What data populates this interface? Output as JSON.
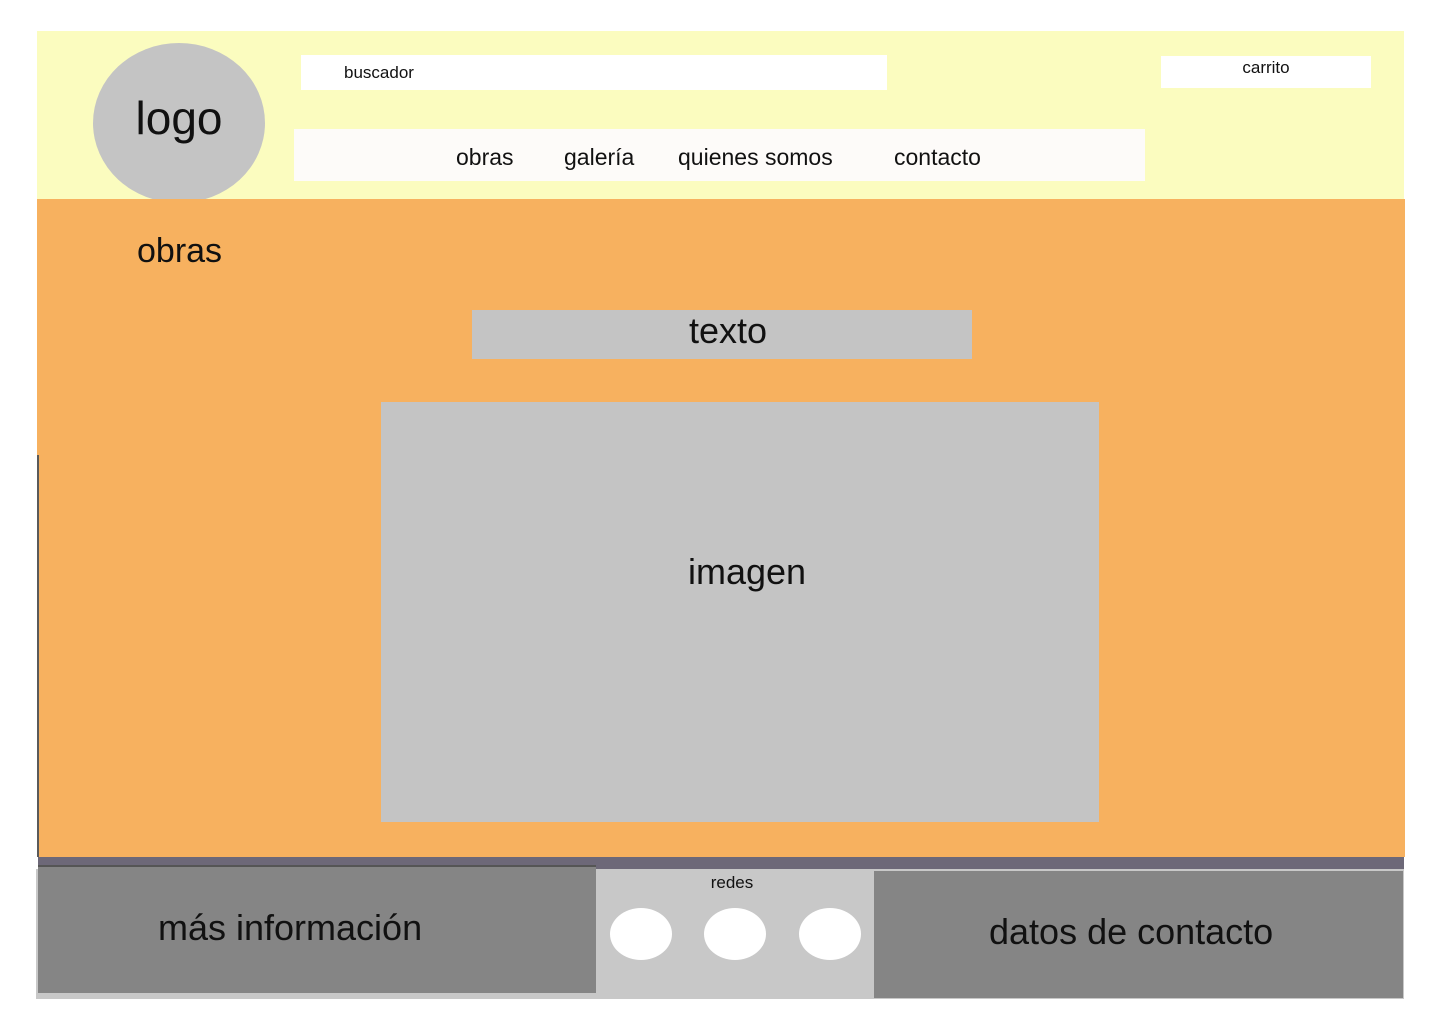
{
  "header": {
    "logo_text": "logo",
    "search": {
      "placeholder": "buscador",
      "value": ""
    },
    "cart_label": "carrito",
    "nav": {
      "items": [
        {
          "label": "obras"
        },
        {
          "label": "galería"
        },
        {
          "label": "quienes somos"
        },
        {
          "label": "contacto"
        }
      ]
    }
  },
  "main": {
    "section_title": "obras",
    "text_block": "texto",
    "image_label": "imagen"
  },
  "footer": {
    "more_info": "más información",
    "social": {
      "label": "redes",
      "icons": [
        "social-icon",
        "social-icon",
        "social-icon"
      ]
    },
    "contact_info": "datos de contacto"
  },
  "colors": {
    "header_bg": "#fbfcbf",
    "main_bg": "#f7b15f",
    "placeholder_gray": "#c4c4c4",
    "footer_dark": "#858585",
    "footer_light": "#c8c8c8",
    "divider": "#6d6878"
  }
}
